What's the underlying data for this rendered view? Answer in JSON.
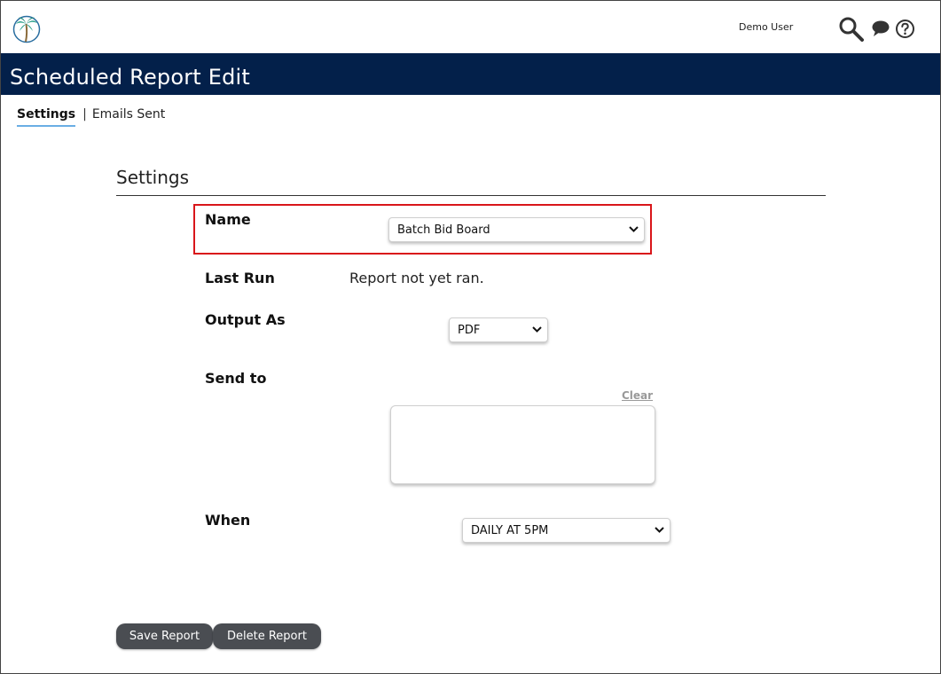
{
  "header": {
    "user_name": "Demo User"
  },
  "page": {
    "title": "Scheduled Report Edit"
  },
  "tabs": [
    {
      "label": "Settings",
      "active": true
    },
    {
      "label": "Emails Sent",
      "active": false
    }
  ],
  "tab_separator": "|",
  "section": {
    "title": "Settings"
  },
  "form": {
    "name_label": "Name",
    "name_value": "Batch Bid Board",
    "last_run_label": "Last Run",
    "last_run_value": "Report not yet ran.",
    "output_label": "Output As",
    "output_value": "PDF",
    "send_to_label": "Send to",
    "send_to_value": "",
    "clear_label": "Clear",
    "when_label": "When",
    "when_value": "DAILY AT 5PM"
  },
  "buttons": {
    "save_label": "Save Report",
    "delete_label": "Delete Report"
  },
  "colors": {
    "title_bar": "#03204a",
    "tab_underline": "#6aaee4",
    "highlight_border": "#d9161a",
    "button_bg": "#4a4d52"
  },
  "icons": {
    "logo": "palm-tree-logo",
    "search": "search-icon",
    "chat": "chat-bubble-icon",
    "help": "help-icon"
  }
}
